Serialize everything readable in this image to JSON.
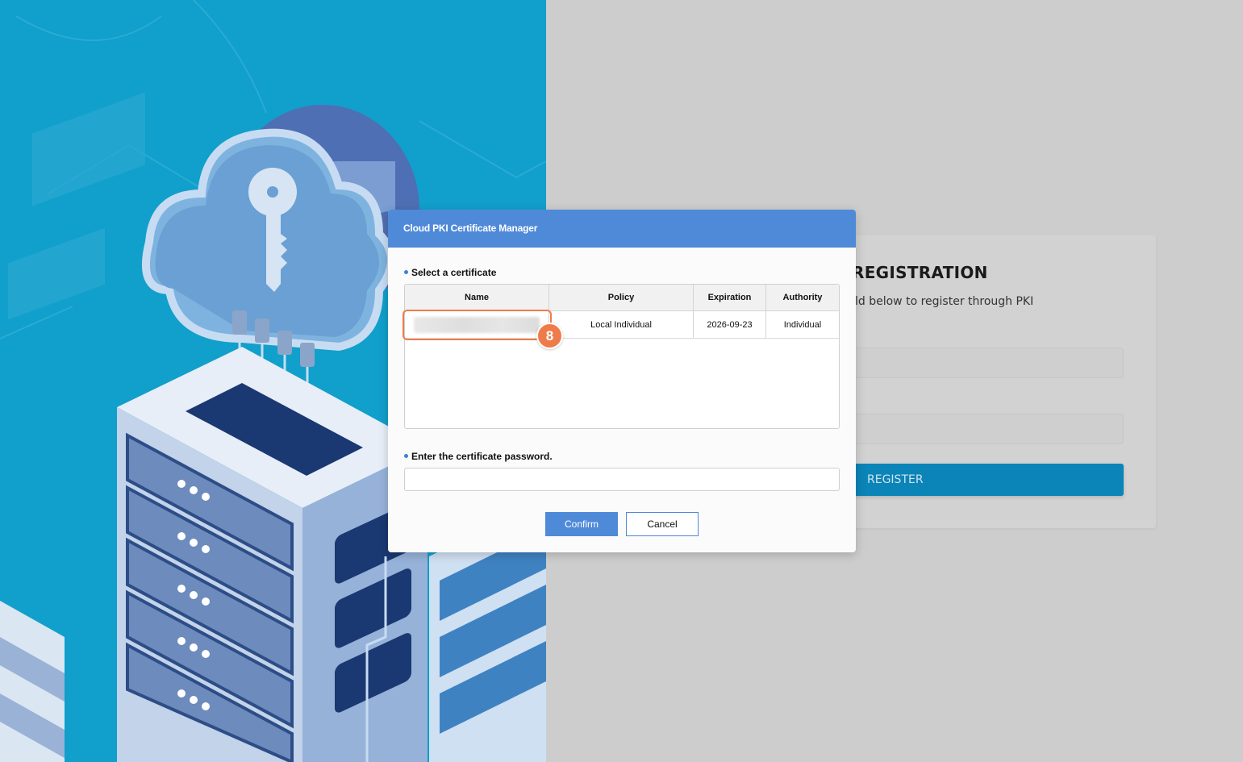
{
  "modal": {
    "title": "Cloud PKI Certificate Manager",
    "select_label": "Select a certificate",
    "password_label": "Enter the certificate password.",
    "password_value": "",
    "password_placeholder": "",
    "confirm_label": "Confirm",
    "cancel_label": "Cancel",
    "table": {
      "headers": [
        "Name",
        "Policy",
        "Expiration",
        "Authority"
      ],
      "rows": [
        {
          "name": "",
          "policy": "Local Individual",
          "expiration": "2026-09-23",
          "authority": "Individual"
        }
      ]
    },
    "accent_color": "#4f8ad9"
  },
  "annotation": {
    "step_number": "8",
    "color": "#ee7c4b"
  },
  "registration": {
    "title": "REGISTRATION",
    "subtitle": "ld below to register through PKI",
    "button_label": "REGISTER",
    "button_color": "#0b84b8"
  },
  "icons": [
    "cloud-key-icon",
    "server-rack-icon"
  ]
}
